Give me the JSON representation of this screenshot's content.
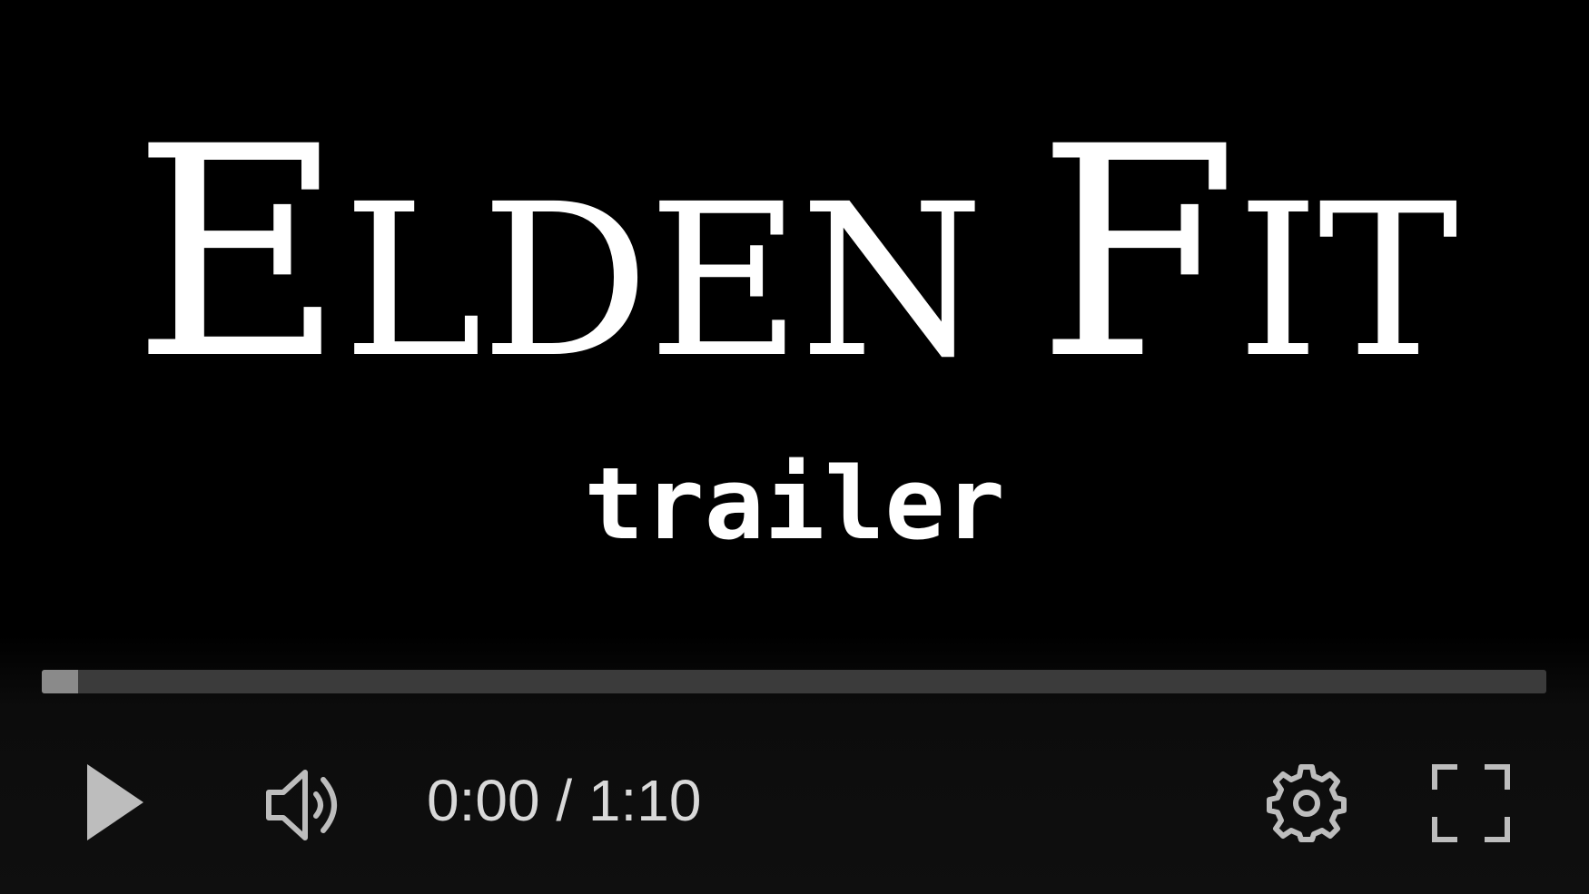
{
  "video": {
    "title_first_initial": "E",
    "title_first_rest": "LDEN",
    "title_second_initial": "F",
    "title_second_rest": "IT",
    "subtitle": "trailer"
  },
  "controls": {
    "current_time": "0:00",
    "separator": "/",
    "duration": "1:10",
    "progress_fraction": 0.024,
    "icons": {
      "play": "play-icon",
      "volume": "volume-icon",
      "settings": "gear-icon",
      "fullscreen": "fullscreen-icon"
    },
    "colors": {
      "icon": "#bdbdbd",
      "track": "#3b3b3b",
      "fill": "#8a8a8a"
    }
  }
}
